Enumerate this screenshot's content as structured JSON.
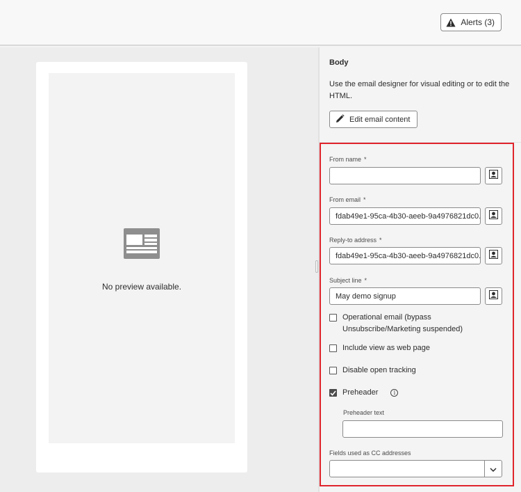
{
  "header": {
    "alerts_label": "Alerts (3)"
  },
  "preview": {
    "empty_text": "No preview available."
  },
  "panel": {
    "body_title": "Body",
    "body_description": "Use the email designer for visual editing or to edit the HTML.",
    "edit_button_label": "Edit email content",
    "fields": {
      "from_name": {
        "label": "From name",
        "value": ""
      },
      "from_email": {
        "label": "From email",
        "value": "fdab49e1-95ca-4b30-aeeb-9a4976821dc0..."
      },
      "reply_to": {
        "label": "Reply-to address",
        "value": "fdab49e1-95ca-4b30-aeeb-9a4976821dc0..."
      },
      "subject": {
        "label": "Subject line",
        "value": "May demo signup"
      }
    },
    "required_marker": "*",
    "checkboxes": {
      "operational": {
        "label_line1": "Operational email (bypass",
        "label_line2": "Unsubscribe/Marketing suspended)",
        "checked": false
      },
      "web_page": {
        "label": "Include view as web page",
        "checked": false
      },
      "open_tracking": {
        "label": "Disable open tracking",
        "checked": false
      },
      "preheader": {
        "label": "Preheader",
        "checked": true
      }
    },
    "preheader_text": {
      "label": "Preheader text",
      "value": ""
    },
    "cc_fields": {
      "label": "Fields used as CC addresses",
      "value": ""
    }
  },
  "icons": {
    "alert": "alert-triangle-icon",
    "edit": "pencil-icon",
    "personalize": "personalization-icon",
    "info": "info-icon",
    "chevron": "chevron-down-icon",
    "preview": "newsletter-layout-icon"
  },
  "colors": {
    "highlight_border": "#e0242c"
  }
}
